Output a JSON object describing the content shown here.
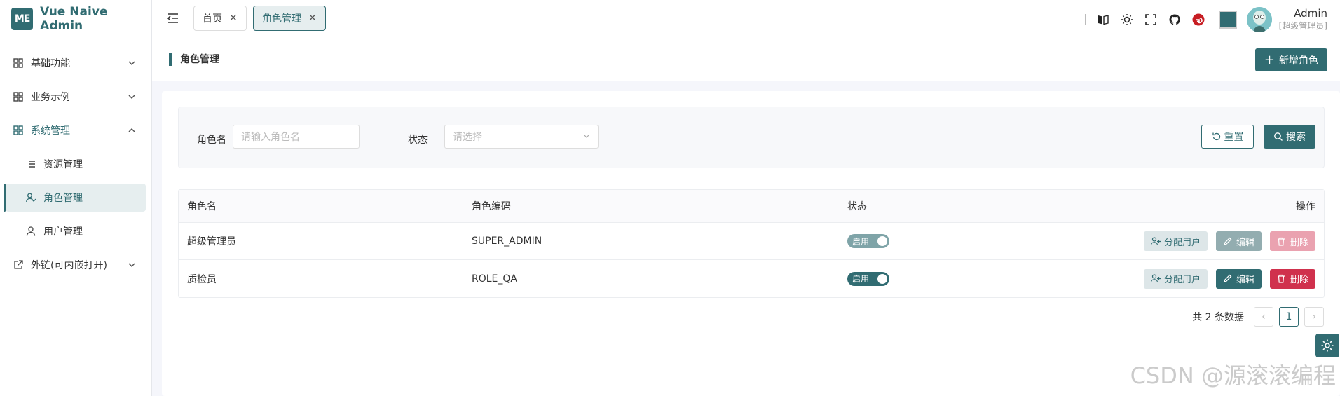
{
  "brand": {
    "logo_text": "ME",
    "app_title": "Vue Naive Admin"
  },
  "sidebar": {
    "items": [
      {
        "label": "基础功能",
        "icon": "grid-icon"
      },
      {
        "label": "业务示例",
        "icon": "grid-icon"
      },
      {
        "label": "系统管理",
        "icon": "grid-icon"
      },
      {
        "label": "资源管理",
        "icon": "list-icon"
      },
      {
        "label": "角色管理",
        "icon": "user-check-icon"
      },
      {
        "label": "用户管理",
        "icon": "user-icon"
      },
      {
        "label": "外链(可内嵌打开)",
        "icon": "external-link-icon"
      }
    ]
  },
  "tabs": [
    {
      "label": "首页"
    },
    {
      "label": "角色管理"
    }
  ],
  "user": {
    "name": "Admin",
    "role": "[超级管理员]"
  },
  "colors": {
    "accent": "#316c72",
    "danger": "#d0314d"
  },
  "page": {
    "title": "角色管理",
    "add_button": "新增角色"
  },
  "search": {
    "role_label": "角色名",
    "role_placeholder": "请输入角色名",
    "status_label": "状态",
    "status_placeholder": "请选择",
    "reset_button": "重置",
    "search_button": "搜索"
  },
  "table": {
    "headers": [
      "角色名",
      "角色编码",
      "状态",
      "操作"
    ],
    "rows": [
      {
        "name": "超级管理员",
        "code": "SUPER_ADMIN",
        "status": "启用",
        "assign": "分配用户",
        "edit": "编辑",
        "delete": "删除"
      },
      {
        "name": "质检员",
        "code": "ROLE_QA",
        "status": "启用",
        "assign": "分配用户",
        "edit": "编辑",
        "delete": "删除"
      }
    ]
  },
  "pagination": {
    "total_text": "共 2 条数据",
    "prev": "‹",
    "current": "1",
    "next": "›"
  },
  "watermark": "CSDN @源滚滚编程"
}
